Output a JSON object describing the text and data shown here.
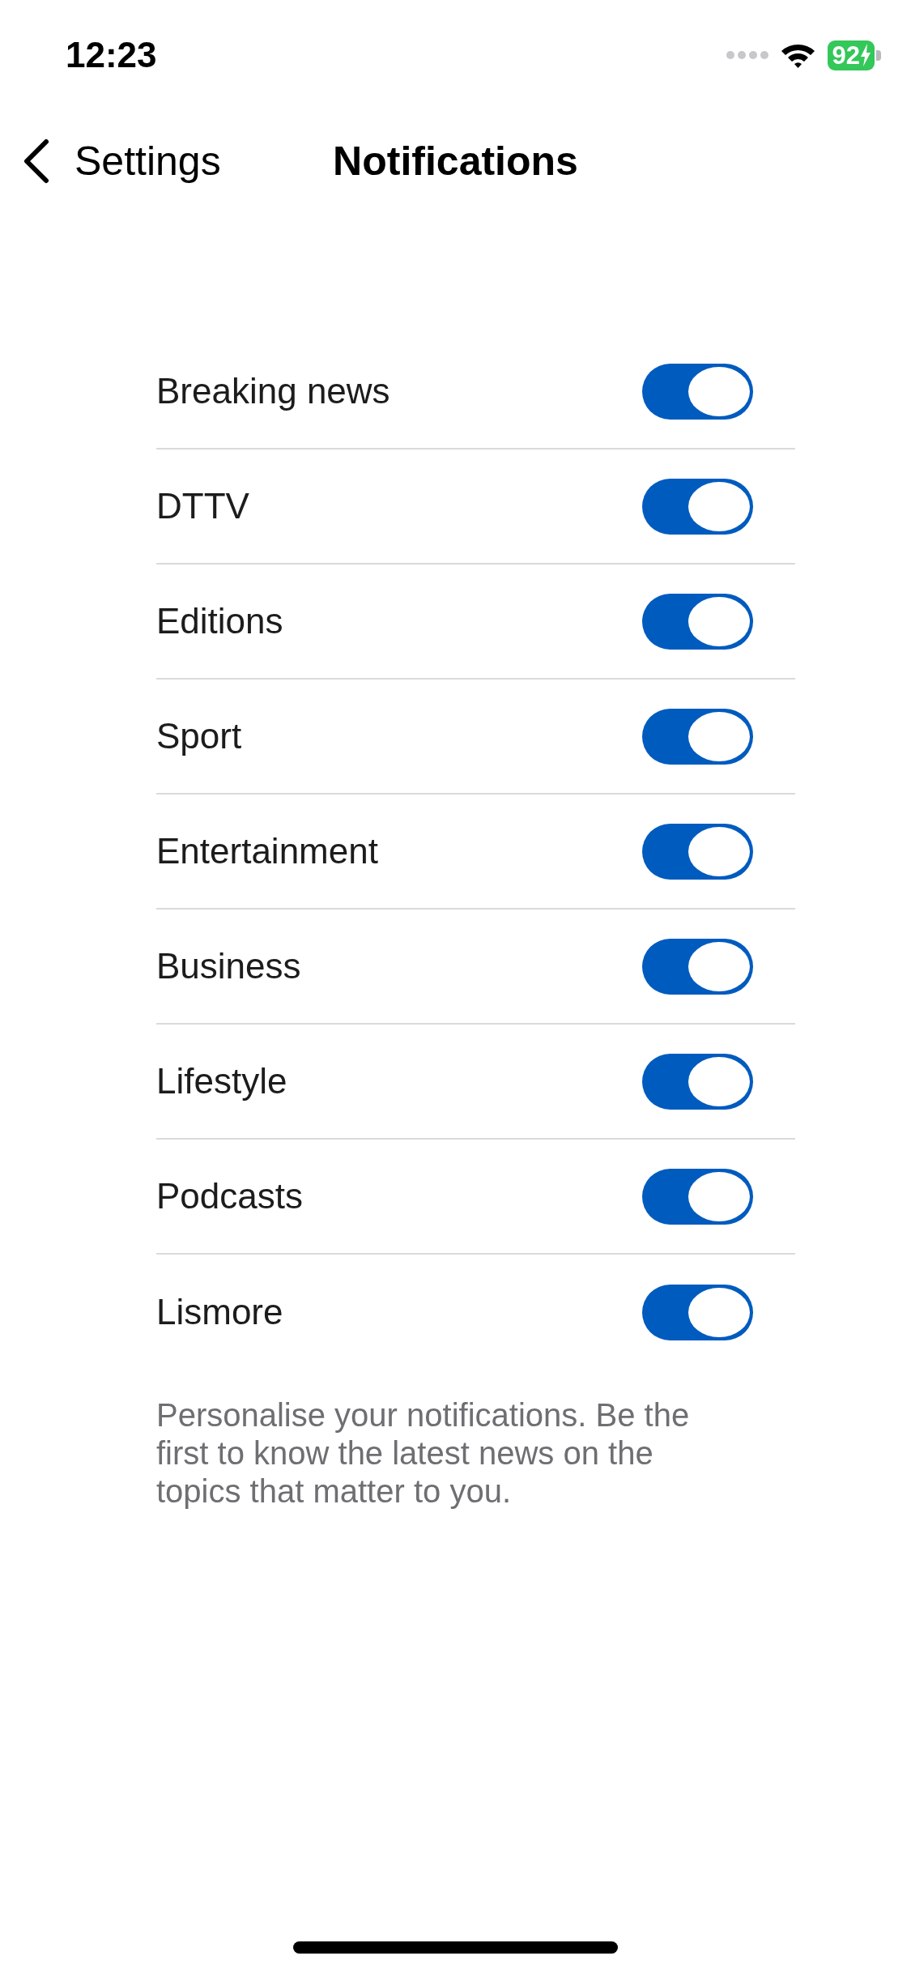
{
  "status_bar": {
    "time": "12:23",
    "battery": "92",
    "charging": true
  },
  "nav_bar": {
    "back_label": "Settings",
    "title": "Notifications"
  },
  "settings": [
    {
      "label": "Breaking news",
      "on": true
    },
    {
      "label": "DTTV",
      "on": true
    },
    {
      "label": "Editions",
      "on": true
    },
    {
      "label": "Sport",
      "on": true
    },
    {
      "label": "Entertainment",
      "on": true
    },
    {
      "label": "Business",
      "on": true
    },
    {
      "label": "Lifestyle",
      "on": true
    },
    {
      "label": "Podcasts",
      "on": true
    },
    {
      "label": "Lismore",
      "on": true
    }
  ],
  "footer_note": "Personalise your notifications. Be the first to know the latest news on the topics that matter to you."
}
